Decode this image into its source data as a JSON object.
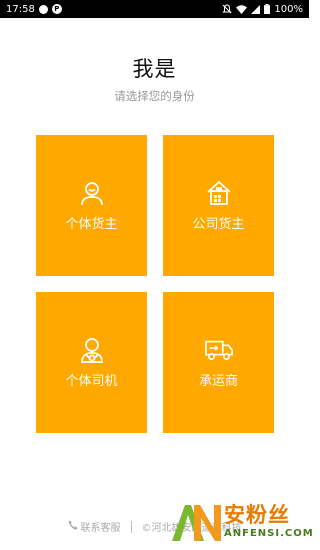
{
  "status_bar": {
    "time": "17:58",
    "notif_p": "P",
    "battery": "100%"
  },
  "header": {
    "title": "我是",
    "subtitle": "请选择您的身份"
  },
  "roles": [
    {
      "label": "个体货主",
      "icon": "person-icon"
    },
    {
      "label": "公司货主",
      "icon": "building-icon"
    },
    {
      "label": "个体司机",
      "icon": "driver-icon"
    },
    {
      "label": "承运商",
      "icon": "truck-icon"
    }
  ],
  "footer": {
    "service_label": "联系客服",
    "copyright": "©河北雄安顺道运科技"
  },
  "watermark": {
    "cn": "安粉丝",
    "en": "ANFENSI.COM"
  },
  "colors": {
    "tile": "#fea800",
    "statusbar": "#000000"
  }
}
